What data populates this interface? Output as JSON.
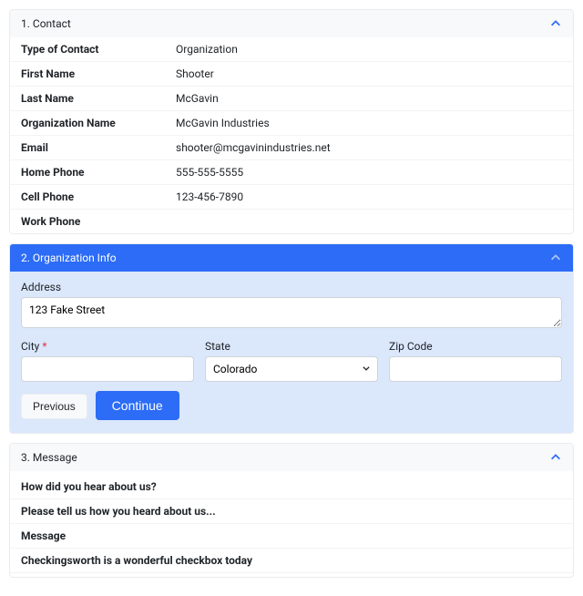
{
  "sections": {
    "contact": {
      "title": "1. Contact",
      "fields": [
        {
          "label": "Type of Contact",
          "value": "Organization"
        },
        {
          "label": "First Name",
          "value": "Shooter"
        },
        {
          "label": "Last Name",
          "value": "McGavin"
        },
        {
          "label": "Organization Name",
          "value": "McGavin Industries"
        },
        {
          "label": "Email",
          "value": "shooter@mcgavinindustries.net"
        },
        {
          "label": "Home Phone",
          "value": "555-555-5555"
        },
        {
          "label": "Cell Phone",
          "value": "123-456-7890"
        },
        {
          "label": "Work Phone",
          "value": ""
        }
      ]
    },
    "org": {
      "title": "2. Organization Info",
      "address_label": "Address",
      "address_value": "123 Fake Street",
      "city_label": "City",
      "city_required": "*",
      "city_value": "",
      "state_label": "State",
      "state_value": "Colorado",
      "zip_label": "Zip Code",
      "zip_value": "",
      "prev_label": "Previous",
      "continue_label": "Continue"
    },
    "message": {
      "title": "3. Message",
      "rows": [
        {
          "label": "How did you hear about us?",
          "value": ""
        },
        {
          "label": "Please tell us how you heard about us...",
          "value": ""
        },
        {
          "label": "Message",
          "value": ""
        },
        {
          "label": "Checkingsworth is a wonderful checkbox today",
          "value": ""
        }
      ]
    }
  }
}
